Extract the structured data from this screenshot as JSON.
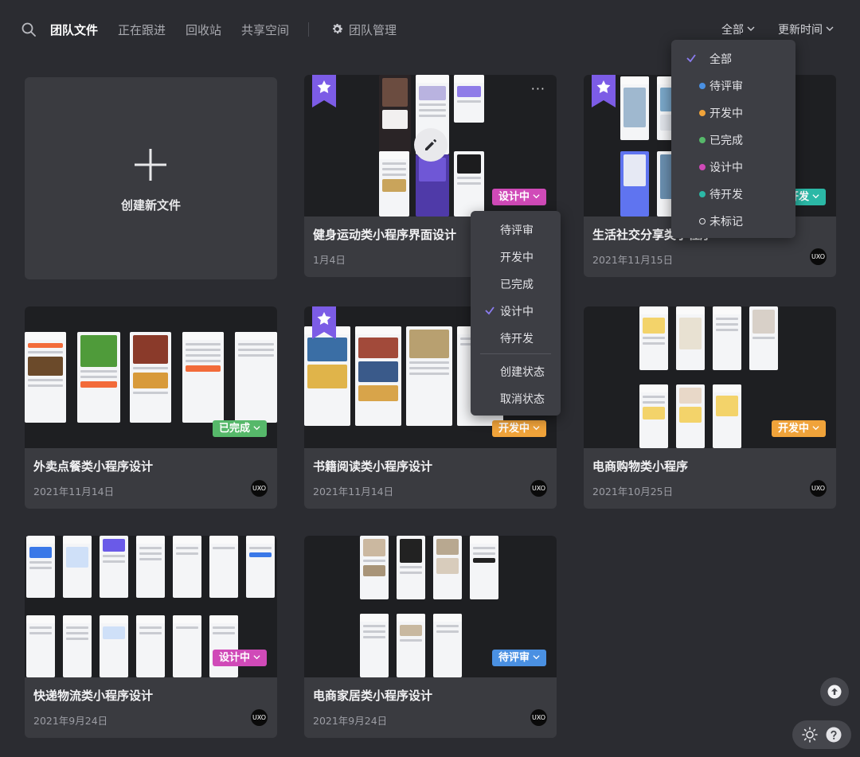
{
  "nav": {
    "tabs": [
      "团队文件",
      "正在跟进",
      "回收站",
      "共享空间"
    ],
    "team_manage": "团队管理",
    "filter_status": "全部",
    "filter_sort": "更新时间"
  },
  "create": {
    "label": "创建新文件"
  },
  "cards": [
    {
      "title": "健身运动类小程序界面设计",
      "date": "1月4日",
      "status": "设计中",
      "status_color": "#d04ab8",
      "starred": true
    },
    {
      "title": "生活社交分享类小程序",
      "date": "2021年11月15日",
      "status": "开发",
      "status_color": "#2bb8a6",
      "starred": true
    },
    {
      "title": "外卖点餐类小程序设计",
      "date": "2021年11月14日",
      "status": "已完成",
      "status_color": "#56b86a",
      "starred": false
    },
    {
      "title": "书籍阅读类小程序设计",
      "date": "2021年11月14日",
      "status": "开发中",
      "status_color": "#f0a33a",
      "starred": true
    },
    {
      "title": "电商购物类小程序",
      "date": "2021年10月25日",
      "status": "开发中",
      "status_color": "#f0a33a",
      "starred": false
    },
    {
      "title": "快递物流类小程序设计",
      "date": "2021年9月24日",
      "status": "设计中",
      "status_color": "#d04ab8",
      "starred": false
    },
    {
      "title": "电商家居类小程序设计",
      "date": "2021年9月24日",
      "status": "待评审",
      "status_color": "#4a90e2",
      "starred": false
    }
  ],
  "avatar_text": "UXO",
  "status_filter_menu": {
    "items": [
      {
        "label": "全部",
        "color": "",
        "checked": true
      },
      {
        "label": "待评审",
        "color": "#4a90e2",
        "checked": false
      },
      {
        "label": "开发中",
        "color": "#f0a33a",
        "checked": false
      },
      {
        "label": "已完成",
        "color": "#56b86a",
        "checked": false
      },
      {
        "label": "设计中",
        "color": "#d04ab8",
        "checked": false
      },
      {
        "label": "待开发",
        "color": "#2bb8a6",
        "checked": false
      },
      {
        "label": "未标记",
        "color": "",
        "checked": false
      }
    ]
  },
  "card_status_menu": {
    "items": [
      "待评审",
      "开发中",
      "已完成",
      "设计中",
      "待开发"
    ],
    "checked": "设计中",
    "actions": [
      "创建状态",
      "取消状态"
    ]
  },
  "icons": {
    "search": "search-icon",
    "gear": "gear-icon",
    "bookmark": "star-bookmark-icon",
    "edit": "pencil-icon",
    "up": "arrow-up-icon",
    "theme": "sun-icon",
    "help": "question-icon"
  }
}
